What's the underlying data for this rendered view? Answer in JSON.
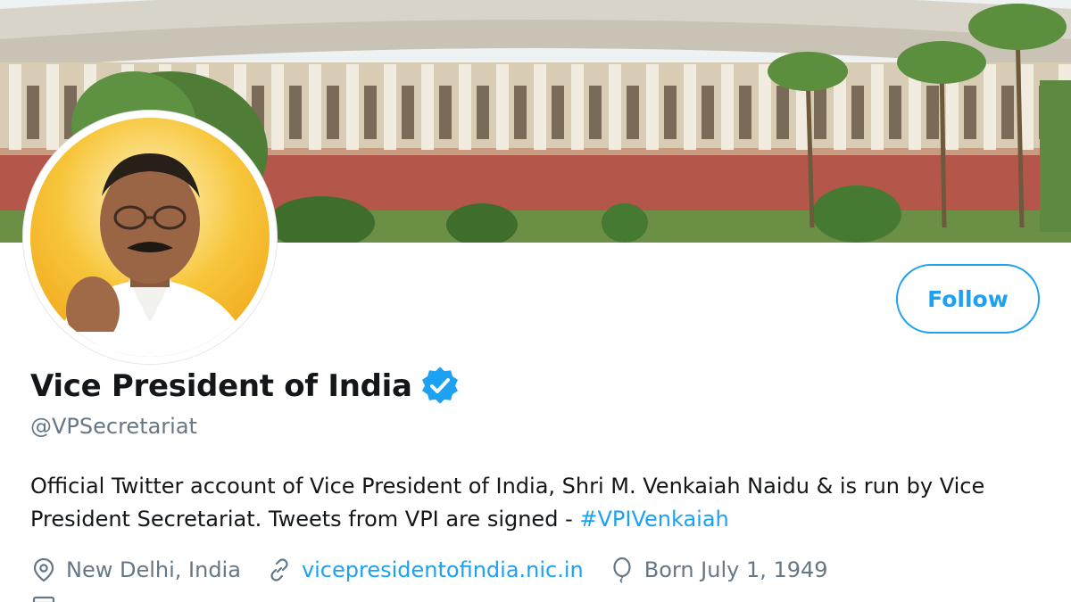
{
  "profile": {
    "display_name": "Vice President of India",
    "handle": "@VPSecretariat",
    "bio_text": "Official Twitter account of Vice President of India, Shri M. Venkaiah Naidu & is run by Vice President Secretariat. Tweets from VPI are signed - ",
    "bio_hashtag": "#VPIVenkaiah",
    "location": "New Delhi, India",
    "website": "vicepresidentofindia.nic.in",
    "birthday": "Born July 1, 1949"
  },
  "actions": {
    "follow_label": "Follow"
  },
  "icons": {
    "verified": "verified-badge-icon",
    "location": "location-pin-icon",
    "website": "link-icon",
    "birthday": "balloon-icon",
    "joined": "calendar-icon"
  },
  "colors": {
    "accent": "#1da1f2",
    "text_primary": "#14171a",
    "text_secondary": "#657786"
  }
}
